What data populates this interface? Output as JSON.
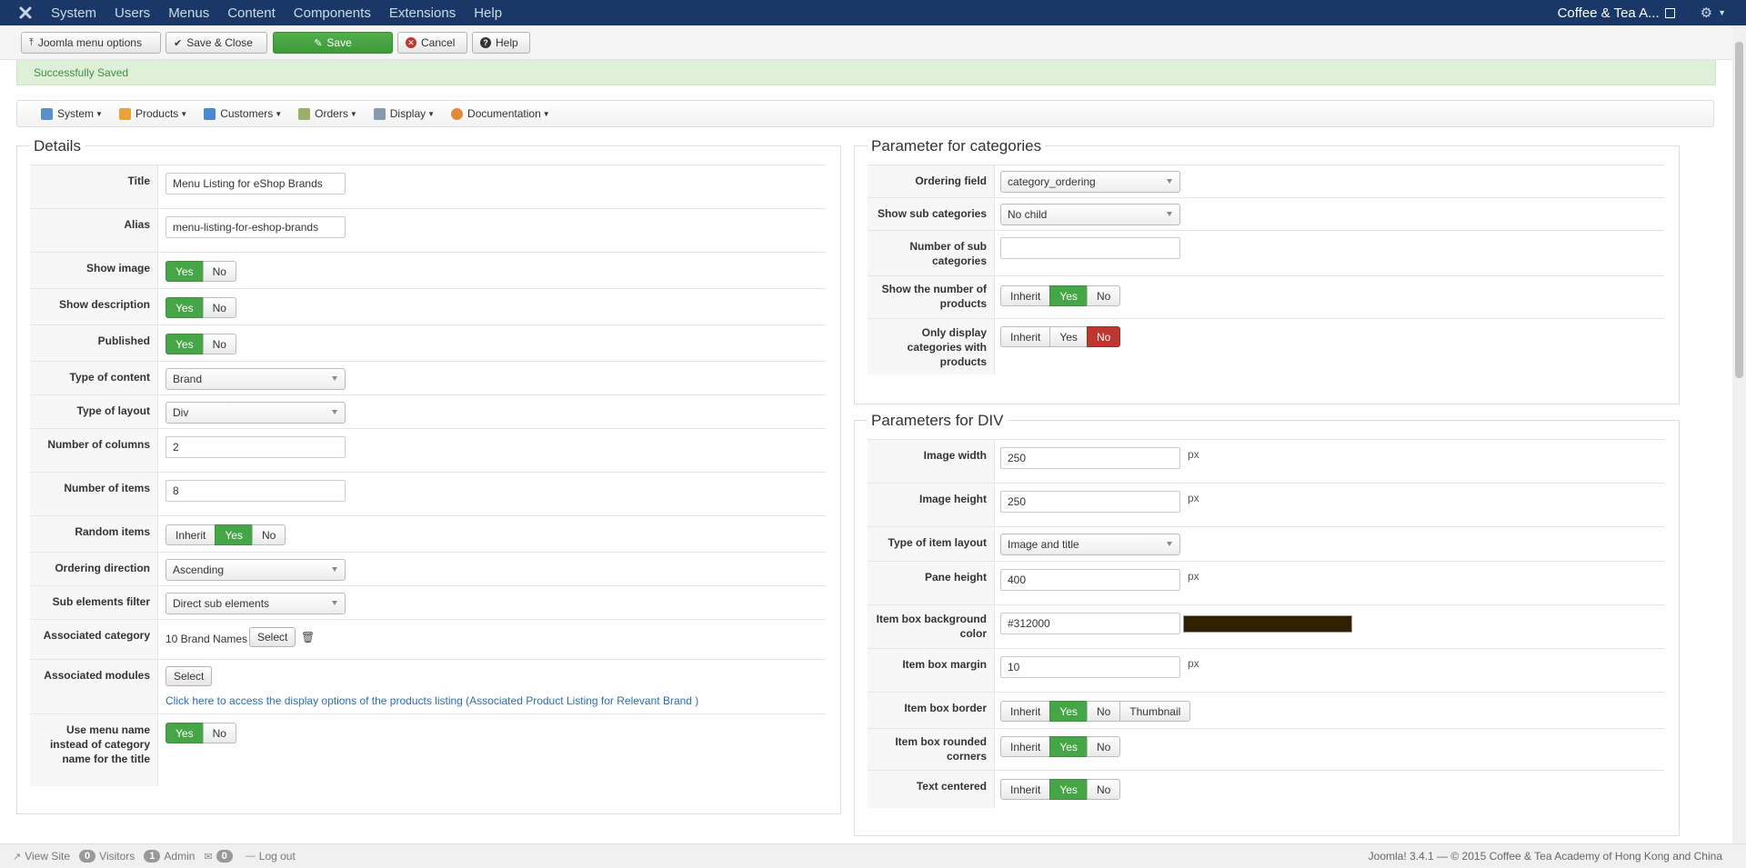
{
  "navbar": {
    "menu": [
      "System",
      "Users",
      "Menus",
      "Content",
      "Components",
      "Extensions",
      "Help"
    ],
    "site_name": "Coffee & Tea A..."
  },
  "toolbar": {
    "menu_options": "Joomla menu options",
    "save_close": "Save & Close",
    "save": "Save",
    "cancel": "Cancel",
    "help": "Help"
  },
  "message": "Successfully Saved",
  "component_nav": [
    "System",
    "Products",
    "Customers",
    "Orders",
    "Display",
    "Documentation"
  ],
  "details": {
    "legend": "Details",
    "title_label": "Title",
    "title_value": "Menu Listing for eShop Brands",
    "alias_label": "Alias",
    "alias_value": "menu-listing-for-eshop-brands",
    "show_image_label": "Show image",
    "show_description_label": "Show description",
    "published_label": "Published",
    "type_content_label": "Type of content",
    "type_content_value": "Brand",
    "type_layout_label": "Type of layout",
    "type_layout_value": "Div",
    "num_columns_label": "Number of columns",
    "num_columns_value": "2",
    "num_items_label": "Number of items",
    "num_items_value": "8",
    "random_items_label": "Random items",
    "ordering_direction_label": "Ordering direction",
    "ordering_direction_value": "Ascending",
    "sub_elements_label": "Sub elements filter",
    "sub_elements_value": "Direct sub elements",
    "assoc_category_label": "Associated category",
    "assoc_category_value": "10 Brand Names",
    "assoc_modules_label": "Associated modules",
    "select_label": "Select",
    "display_options_link": "Click here to access the display options of the products listing (Associated Product Listing for Relevant Brand )",
    "use_menu_name_label": "Use menu name instead of category name for the title"
  },
  "toggle": {
    "yes": "Yes",
    "no": "No",
    "inherit": "Inherit",
    "thumbnail": "Thumbnail"
  },
  "categories": {
    "legend": "Parameter for categories",
    "ordering_field_label": "Ordering field",
    "ordering_field_value": "category_ordering",
    "show_sub_label": "Show sub categories",
    "show_sub_value": "No child",
    "num_sub_label": "Number of sub categories",
    "num_sub_value": "",
    "show_num_products_label": "Show the number of products",
    "only_display_label": "Only display categories with products"
  },
  "div_params": {
    "legend": "Parameters for DIV",
    "unit": "px",
    "image_width_label": "Image width",
    "image_width_value": "250",
    "image_height_label": "Image height",
    "image_height_value": "250",
    "item_layout_label": "Type of item layout",
    "item_layout_value": "Image and title",
    "pane_height_label": "Pane height",
    "pane_height_value": "400",
    "bg_color_label": "Item box background color",
    "bg_color_value": "#312000",
    "margin_label": "Item box margin",
    "margin_value": "10",
    "border_label": "Item box border",
    "rounded_label": "Item box rounded corners",
    "text_centered_label": "Text centered"
  },
  "colors": {
    "swatch": "#312000"
  },
  "statusbar": {
    "view_site": "View Site",
    "visitors_count": "0",
    "visitors": "Visitors",
    "admin_count": "1",
    "admin": "Admin",
    "messages_count": "0",
    "logout": "Log out",
    "copyright": "Joomla! 3.4.1  —  © 2015 Coffee & Tea Academy of Hong Kong and China"
  }
}
